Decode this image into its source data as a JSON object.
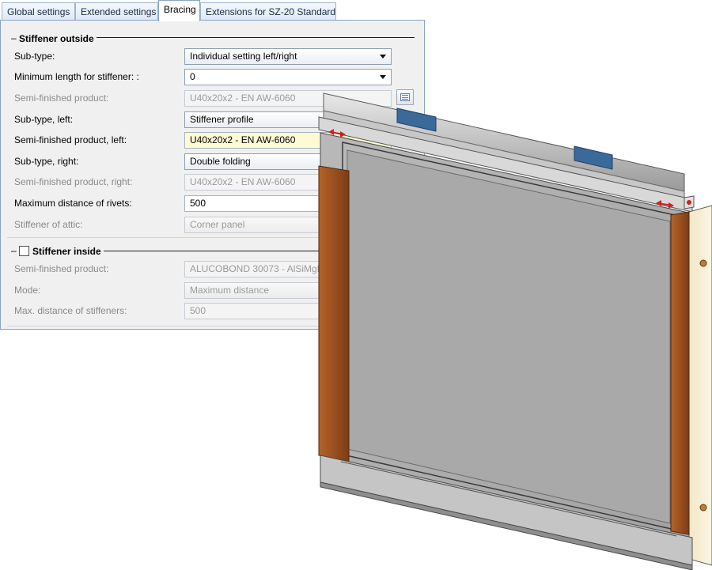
{
  "tabs": [
    {
      "label": "Global settings",
      "active": false
    },
    {
      "label": "Extended settings",
      "active": false
    },
    {
      "label": "Bracing",
      "active": true
    },
    {
      "label": "Extensions for SZ-20 Standard",
      "active": false
    }
  ],
  "stiffener_outside": {
    "title": "Stiffener outside",
    "collapse_symbol": "–",
    "rows": [
      {
        "label": "Sub-type:",
        "value": "Individual setting left/right"
      },
      {
        "label": "Minimum length for stiffener:   :",
        "value": "0"
      },
      {
        "label": "Semi-finished product:",
        "value": "U40x20x2 - EN AW-6060"
      },
      {
        "label": "Sub-type, left:",
        "value": "Stiffener profile"
      },
      {
        "label": "Semi-finished product, left:",
        "value": "U40x20x2 - EN AW-6060"
      },
      {
        "label": "Sub-type, right:",
        "value": "Double folding"
      },
      {
        "label": "Semi-finished product, right:",
        "value": "U40x20x2 - EN AW-6060"
      },
      {
        "label": "Maximum distance of rivets:",
        "value": "500"
      },
      {
        "label": "Stiffener of attic:",
        "value": "Corner panel"
      }
    ]
  },
  "stiffener_inside": {
    "title": "Stiffener inside",
    "collapse_symbol": "–",
    "checked": false,
    "rows": [
      {
        "label": "Semi-finished product:",
        "value": "ALUCOBOND 30073 - AlSiMgMn"
      },
      {
        "label": "Mode:",
        "value": "Maximum distance"
      },
      {
        "label": "Max. distance of stiffeners:",
        "value": "500"
      }
    ]
  },
  "icons": {
    "dropdown": "chevron-down-icon",
    "browse": "catalog-browse-icon"
  },
  "colors": {
    "tab_border": "#8aa3c3",
    "panel_bg": "#f0f0f0",
    "field_highlight": "#fdfbd3",
    "disabled_text": "#8a8a8a",
    "stiffener_brown": "#9a4f1f",
    "marker_blue": "#3a6a9a",
    "panel_gray": "#a8a8a8"
  }
}
